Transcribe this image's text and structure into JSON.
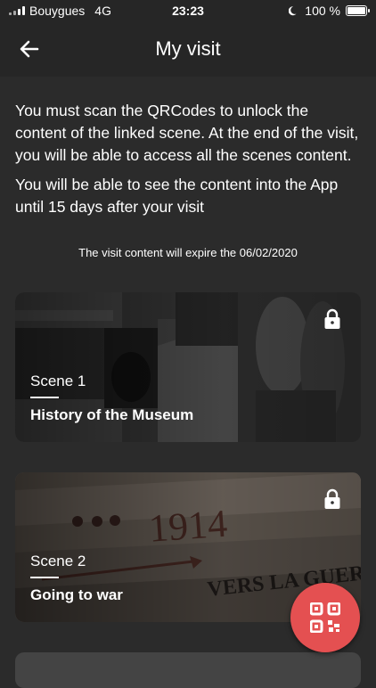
{
  "status_bar": {
    "carrier": "Bouygues",
    "network": "4G",
    "time": "23:23",
    "battery": "100 %"
  },
  "header": {
    "title": "My visit",
    "back_icon": "arrow-left-icon"
  },
  "intro": {
    "paragraph1": "You must scan the QRCodes to unlock the content of the linked scene. At the end of the visit, you will be able to access all the scenes content.",
    "paragraph2": "You will be able to see the content into the App until 15 days after your visit",
    "expire": "The visit content will expire the 06/02/2020"
  },
  "scenes": [
    {
      "number": "Scene 1",
      "name": "History of the Museum",
      "locked": true,
      "icon": "lock-icon"
    },
    {
      "number": "Scene 2",
      "name": "Going to war",
      "locked": true,
      "icon": "lock-icon"
    }
  ],
  "fab": {
    "icon": "qr-code-icon"
  },
  "colors": {
    "background": "#2b2b2b",
    "header": "#262626",
    "accent": "#e45051",
    "text": "#ffffff"
  }
}
